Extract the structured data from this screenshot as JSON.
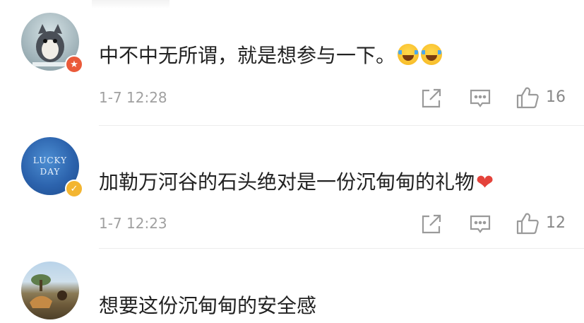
{
  "comments": [
    {
      "avatar_icon": "cat-avatar-icon",
      "badge_icon": "star-badge-icon",
      "text": "中不中无所谓，就是想参与一下。",
      "emoji": [
        "laugh-cry-emoji",
        "laugh-cry-emoji"
      ],
      "time": "1-7 12:28",
      "likes": "16"
    },
    {
      "avatar_icon": "lucky-day-avatar-icon",
      "avatar_text_1": "LUCKY",
      "avatar_text_2": "DAY",
      "badge_icon": "verified-v-badge-icon",
      "text": "加勒万河谷的石头绝对是一份沉甸甸的礼物",
      "emoji": [
        "heart-emoji"
      ],
      "time": "1-7 12:23",
      "likes": "12"
    },
    {
      "avatar_icon": "landscape-avatar-icon",
      "text": "想要这份沉甸甸的安全感"
    }
  ],
  "actions": {
    "share_icon": "share-icon",
    "comment_icon": "comment-icon",
    "like_icon": "thumbs-up-icon"
  },
  "colors": {
    "text": "#222222",
    "meta": "#a0a0a0",
    "icon": "#9a9a9a",
    "badge_red": "#ea5a3a",
    "badge_gold": "#f3b531",
    "heart": "#e4433b"
  }
}
